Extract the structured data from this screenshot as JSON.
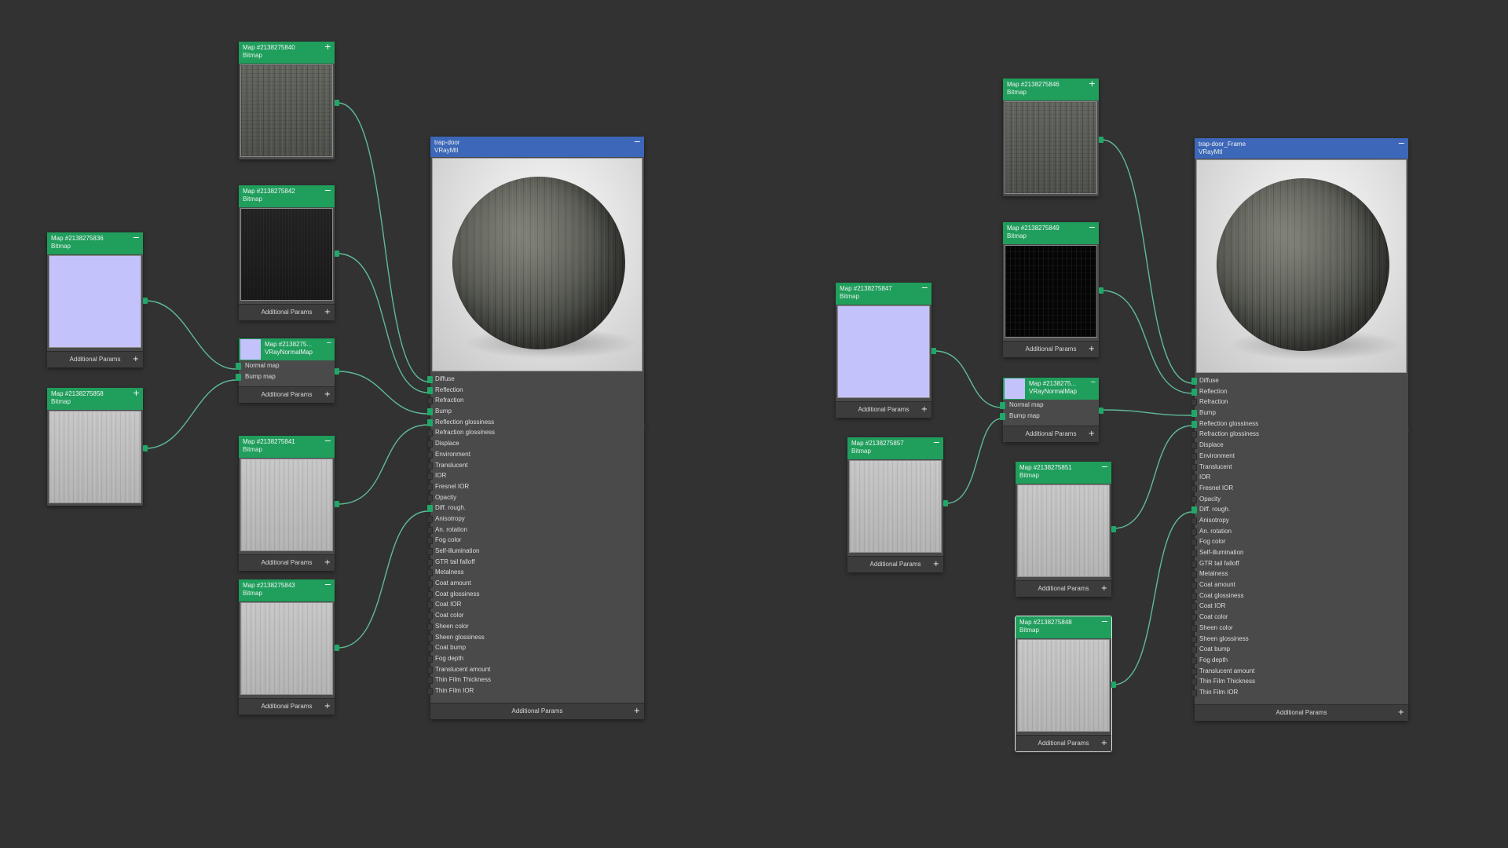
{
  "colors": {
    "background": "#323232",
    "node_body": "#4a4a4a",
    "map_header": "#1f9e5c",
    "material_header": "#3d67b8",
    "wire": "#5fb99a",
    "normal_swatch": "#c4c2fb"
  },
  "common": {
    "subtitle_bitmap": "Bitmap",
    "additional_params": "Additional Params",
    "collapse_glyph": "−",
    "add_glyph": "+"
  },
  "left_graph": {
    "nodes": {
      "n5840": {
        "title": "Map #2138275840",
        "subtitle": "Bitmap",
        "texture": "grunge-texture"
      },
      "n5842": {
        "title": "Map #2138275842",
        "subtitle": "Bitmap",
        "texture": "dark-texture"
      },
      "n5836": {
        "title": "Map #2138275836",
        "subtitle": "Bitmap",
        "texture": "normal-texture"
      },
      "n5858": {
        "title": "Map #2138275858",
        "subtitle": "Bitmap",
        "texture": "light-texture"
      },
      "n5841": {
        "title": "Map #2138275841",
        "subtitle": "Bitmap",
        "texture": "light-texture"
      },
      "n5843": {
        "title": "Map #2138275843",
        "subtitle": "Bitmap",
        "texture": "light-texture"
      },
      "normal": {
        "title": "Map #2138275...",
        "subtitle": "VRayNormalMap",
        "rows": [
          "Normal map",
          "Bump map"
        ]
      }
    },
    "material": {
      "title": "trap-door",
      "subtitle": "VRayMtl",
      "preview": "sphere-preview"
    }
  },
  "right_graph": {
    "nodes": {
      "n5846": {
        "title": "Map #2138275846",
        "subtitle": "Bitmap",
        "texture": "grunge-texture"
      },
      "n5849": {
        "title": "Map #2138275849",
        "subtitle": "Bitmap",
        "texture": "black-texture"
      },
      "n5847": {
        "title": "Map #2138275847",
        "subtitle": "Bitmap",
        "texture": "normal-texture"
      },
      "n5857": {
        "title": "Map #2138275857",
        "subtitle": "Bitmap",
        "texture": "light-texture"
      },
      "n5851": {
        "title": "Map #2138275851",
        "subtitle": "Bitmap",
        "texture": "light-texture"
      },
      "n5848": {
        "title": "Map #2138275848",
        "subtitle": "Bitmap",
        "texture": "light-texture"
      },
      "normal": {
        "title": "Map #2138275...",
        "subtitle": "VRayNormalMap",
        "rows": [
          "Normal map",
          "Bump map"
        ]
      }
    },
    "material": {
      "title": "trap-door_Frame",
      "subtitle": "VRayMtl",
      "preview": "sphere-preview"
    }
  },
  "material_slots": [
    "Diffuse",
    "Reflection",
    "Refraction",
    "Bump",
    "Reflection glossiness",
    "Refraction glossiness",
    "Displace",
    "Environment",
    "Translucent",
    "IOR",
    "Fresnel IOR",
    "Opacity",
    "Diff. rough.",
    "Anisotropy",
    "An. rotation",
    "Fog color",
    "Self-illumination",
    "GTR tail falloff",
    "Metalness",
    "Coat amount",
    "Coat glossiness",
    "Coat IOR",
    "Coat color",
    "Sheen color",
    "Sheen glossiness",
    "Coat bump",
    "Fog depth",
    "Translucent amount",
    "Thin Film Thickness",
    "Thin Film IOR"
  ],
  "connected_slots": [
    "Diffuse",
    "Reflection",
    "Bump",
    "Reflection glossiness",
    "Diff. rough."
  ]
}
